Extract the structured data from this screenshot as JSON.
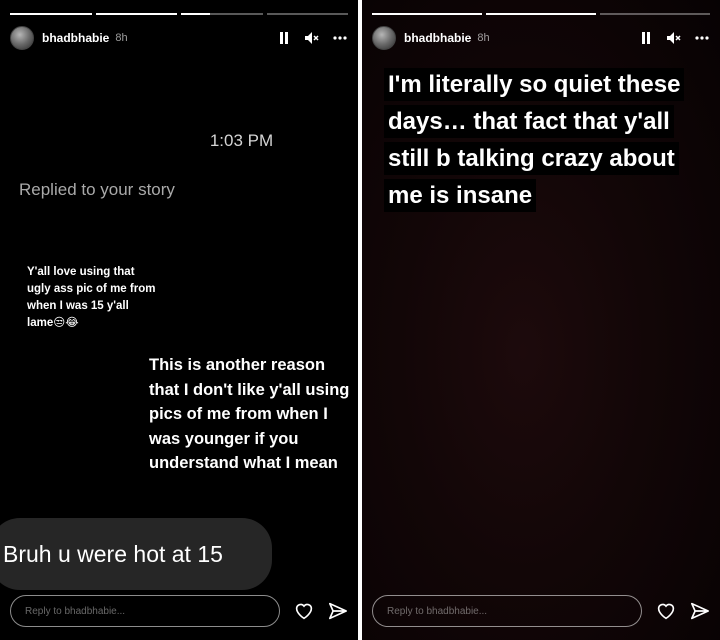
{
  "left_story": {
    "progress": [
      1,
      1,
      0.35,
      0
    ],
    "username": "bhadbhabie",
    "time_ago": "8h",
    "timestamp": "1:03 PM",
    "replied_label": "Replied to your story",
    "caption": "Y'all love using that ugly ass pic of me from when I was 15 y'all lame😒😂",
    "reason_text": "This is another reason that I don't like y'all using pics of me from when I was younger if you understand what I mean",
    "message_text": "Bruh u were hot at 15",
    "reply_placeholder": "Reply to bhadbhabie..."
  },
  "right_story": {
    "progress": [
      1,
      1,
      0
    ],
    "username": "bhadbhabie",
    "time_ago": "8h",
    "quote": "I'm literally so quiet these days… that fact that y'all still b talking crazy about me is insane",
    "reply_placeholder": "Reply to bhadbhabie..."
  },
  "icons": {
    "pause": "pause-icon",
    "mute": "mute-icon",
    "more": "more-options-icon",
    "like": "heart-icon",
    "share": "send-icon"
  }
}
